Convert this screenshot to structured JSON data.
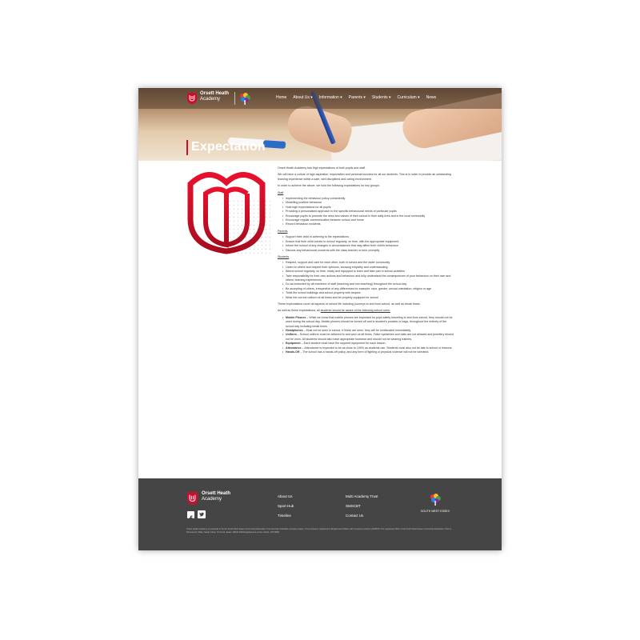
{
  "brand": {
    "line1": "Orsett Heath",
    "line2": "Academy",
    "accent": "#c8102e"
  },
  "nav": [
    {
      "label": "Home"
    },
    {
      "label": "About Us ▾"
    },
    {
      "label": "Information ▾"
    },
    {
      "label": "Parents ▾"
    },
    {
      "label": "Students ▾"
    },
    {
      "label": "Curriculum ▾"
    },
    {
      "label": "News"
    }
  ],
  "hero": {
    "title": "Expectation"
  },
  "content": {
    "intro1": "Orsett Heath Academy has high expectations of both pupils and staff.",
    "intro2": "We will have a culture of high aspiration, expectation and personal success for all our students. This is in order to provide an outstanding learning experience within a safe, well disciplined and caring environment.",
    "intro3": "In order to achieve the above, we hold the following expectations for key groups:",
    "staff_heading": "Staff",
    "staff_items": [
      "Implementing the behaviour policy consistently",
      "Modelling positive behaviour",
      "Hold high expectations for all pupils",
      "Providing a personalised approach to the specific behavioural needs of particular pupils",
      "Encourage pupils to promote the aims and values of their school in their daily lives and in the local community",
      "Encourage regular communication between school and home",
      "Record behaviour incidents"
    ],
    "parents_heading": "Parents",
    "parents_items": [
      "Support their child in adhering to the expectations",
      "Ensure that their child comes to school regularly, on time, with the appropriate equipment",
      "Inform the school of any changes in circumstances that may affect their child's behaviour",
      "Discuss any behavioural concerns with the class teacher or tutor promptly"
    ],
    "students_heading": "Students",
    "students_items": [
      "Respect, support and care for each other, both in school and the wider community",
      "Listen to others and respect their opinions, showing empathy and understanding",
      "Attend school regularly, on time, ready and equipped to learn and take part in school activities",
      "Take responsibility for their own actions and behaviour and fully understand the consequences of poor behaviour on their own and others' learning experiences",
      "Do as instructed by all members of staff (teaching and non-teaching) throughout the school day",
      "Be accepting of others, irrespective of any differences for example: race, gender, sexual orientation, religion or age",
      "Treat the school buildings and school property with respect",
      "Wear the correct uniform at all times and be properly equipped for school"
    ],
    "cover_para": "These expectations cover all aspects of school life including journeys to and from school, as well as break times.",
    "aware_prefix": "As well as these expectations, all ",
    "aware_link": "students should be aware of the following school rules:",
    "rules": [
      {
        "term": "Mobile Phones",
        "text": " – While we know that mobile phones are important for pupil safety travelling to and from school, they should not be used during the school day. Mobile phones should be turned off and in student's pockets or bags, throughout the entirety of the school day including break times."
      },
      {
        "term": "Headphones",
        "text": " – Must not be seen in school. If these are seen, they will be confiscated immediately."
      },
      {
        "term": "Uniform",
        "text": " – School uniform must be adhered to and worn at all times. False eyelashes and nails are not allowed and jewellery should not be worn. All students should also have appropriate footwear and should not be wearing trainers."
      },
      {
        "term": "Equipment",
        "text": " – Each student must have the required equipment for each lesson."
      },
      {
        "term": "Attendance",
        "text": " – Attendance is expected to be as close to 100% as students can. Students must also not be late to school or lessons."
      },
      {
        "term": "Hands-Off",
        "text": " – The school has a hands-off policy, and any form of fighting or physical violence will not be tolerated."
      }
    ]
  },
  "footer": {
    "name1": "Orsett Heath",
    "name2": "Academy",
    "col1": [
      "About Us",
      "Sport Hub",
      "Timeline"
    ],
    "col2": [
      "Multi Academy Trust",
      "SMSCBT",
      "Contact Us"
    ],
    "partner": "SOUTH WEST ESSEX",
    "legal": "Orsett Heath Academy is proposed to be the South West Essex Community Education Trust and has charitable company status. It is a company registered in England and Wales with company number 12345678. The registered office of the South West Essex Community Education Trust is: Pamela Ann Wale, Sandy Close, Thurrock, Essex. RM16 3SE Registered as a free school.",
    "company_no": "11074683"
  }
}
